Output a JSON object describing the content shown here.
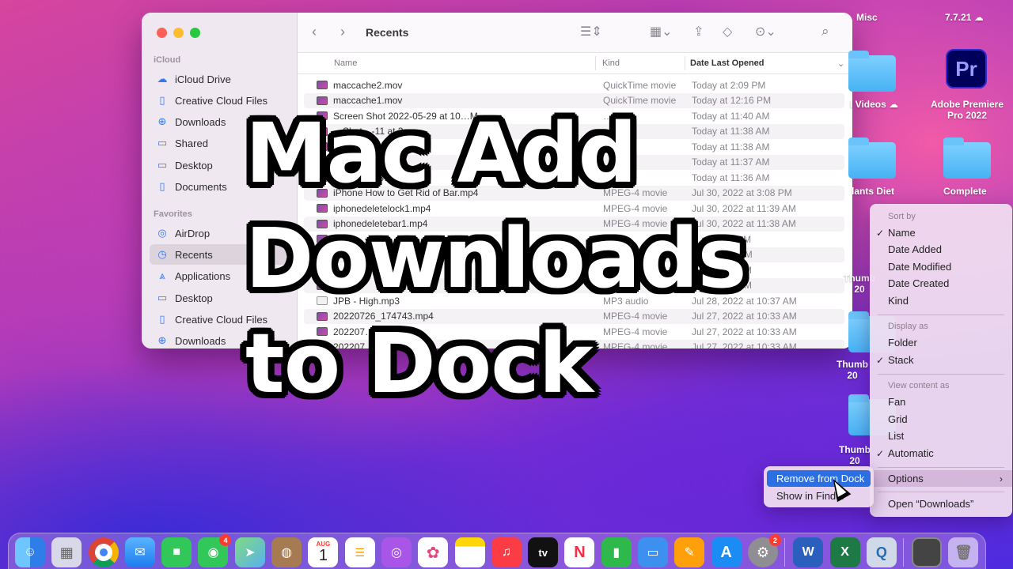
{
  "finder": {
    "title": "Recents",
    "sidebar": {
      "sections": [
        {
          "label": "iCloud",
          "items": [
            "iCloud Drive",
            "Creative Cloud Files",
            "Downloads",
            "Shared",
            "Desktop",
            "Documents"
          ]
        },
        {
          "label": "Favorites",
          "items": [
            "AirDrop",
            "Recents",
            "Applications",
            "Desktop",
            "Creative Cloud Files",
            "Downloads"
          ]
        }
      ],
      "active": "Recents"
    },
    "columns": {
      "name": "Name",
      "kind": "Kind",
      "date": "Date Last Opened"
    },
    "rows": [
      {
        "name": "maccache2.mov",
        "kind": "QuickTime movie",
        "date": "Today at 2:09 PM"
      },
      {
        "name": "maccache1.mov",
        "kind": "QuickTime movie",
        "date": "Today at 12:16 PM"
      },
      {
        "name": "Screen Shot 2022-05-29 at 10…M",
        "kind": "…age",
        "date": "Today at 11:40 AM"
      },
      {
        "name": "…Shot…-11 at 3.…",
        "kind": "…age",
        "date": "Today at 11:38 AM"
      },
      {
        "name": "…-10 at 6…",
        "kind": "…age",
        "date": "Today at 11:38 AM"
      },
      {
        "name": "…2-0…28 at…",
        "kind": "…age",
        "date": "Today at 11:37 AM"
      },
      {
        "name": "…14 …3.18…",
        "kind": "…age",
        "date": "Today at 11:36 AM"
      },
      {
        "name": "iPhone How to Get Rid of Bar.mp4",
        "kind": "MPEG-4 movie",
        "date": "Jul 30, 2022 at 3:08 PM"
      },
      {
        "name": "iphonedeletelock1.mp4",
        "kind": "MPEG-4 movie",
        "date": "Jul 30, 2022 at 11:39 AM"
      },
      {
        "name": "iphonedeletebar1.mp4",
        "kind": "MPEG-4 movie",
        "date": "Jul 30, 2022 at 11:38 AM"
      },
      {
        "name": "",
        "kind": "",
        "date": "…at 11:34 AM"
      },
      {
        "name": "",
        "kind": "",
        "date": "…at 10:08 PM"
      },
      {
        "name": "",
        "kind": "",
        "date": "…at 10:51 AM"
      },
      {
        "name": "…2…",
        "kind": "",
        "date": "…at 10:50 AM"
      },
      {
        "name": "JPB - High.mp3",
        "kind": "MP3 audio",
        "date": "Jul 28, 2022 at 10:37 AM"
      },
      {
        "name": "20220726_174743.mp4",
        "kind": "MPEG-4 movie",
        "date": "Jul 27, 2022 at 10:33 AM"
      },
      {
        "name": "202207…4",
        "kind": "MPEG-4 movie",
        "date": "Jul 27, 2022 at 10:33 AM"
      },
      {
        "name": "202207…",
        "kind": "MPEG-4 movie",
        "date": "Jul 27, 2022 at 10:33 AM"
      }
    ]
  },
  "overlay": {
    "line1": "Mac Add",
    "line2": "Downloads",
    "line3": "to Dock"
  },
  "desktop": {
    "misc": "Misc",
    "version": "7.7.21",
    "videos": "l Videos",
    "premiere_icon": "Pr",
    "premiere_line1": "Adobe Premiere",
    "premiere_line2": "Pro 2022",
    "diet": "lants Diet",
    "complete": "Complete",
    "thumb1": "Thumb",
    "thumb1b": "20",
    "thumb2": "Thumb",
    "thumb2b": "20",
    "thumb3": "Thumb",
    "thumb3b": "20"
  },
  "context_menu": {
    "sort_by": "Sort by",
    "sort_items": [
      "Name",
      "Date Added",
      "Date Modified",
      "Date Created",
      "Kind"
    ],
    "sort_checked": "Name",
    "display_as": "Display as",
    "display_items": [
      "Folder",
      "Stack"
    ],
    "display_checked": "Stack",
    "view_as": "View content as",
    "view_items": [
      "Fan",
      "Grid",
      "List",
      "Automatic"
    ],
    "view_checked": "Automatic",
    "options": "Options",
    "open": "Open “Downloads”"
  },
  "options_submenu": {
    "remove": "Remove from Dock",
    "show": "Show in Finder"
  },
  "dock": {
    "calendar_month": "AUG",
    "calendar_day": "1",
    "messages_badge": "4",
    "settings_badge": "2",
    "tv_label": "tv",
    "word_label": "W",
    "excel_label": "X"
  },
  "colors": {
    "accent": "#2b6fe3",
    "folder": "#47b2f4"
  }
}
